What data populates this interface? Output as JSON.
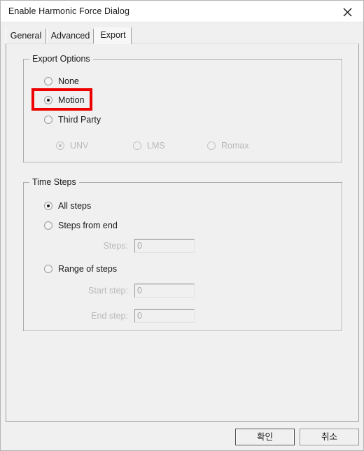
{
  "window": {
    "title": "Enable Harmonic Force Dialog",
    "close_icon": "close-icon"
  },
  "tabs": [
    {
      "id": "general",
      "label": "General",
      "selected": false
    },
    {
      "id": "advanced",
      "label": "Advanced",
      "selected": false
    },
    {
      "id": "export",
      "label": "Export",
      "selected": true
    }
  ],
  "export_options": {
    "group_title": "Export Options",
    "radios": [
      {
        "id": "none",
        "label": "None",
        "checked": false,
        "disabled": false
      },
      {
        "id": "motion",
        "label": "Motion",
        "checked": true,
        "disabled": false
      },
      {
        "id": "third_party",
        "label": "Third Party",
        "checked": false,
        "disabled": false
      }
    ],
    "formats": [
      {
        "id": "unv",
        "label": "UNV",
        "checked": true,
        "disabled": true
      },
      {
        "id": "lms",
        "label": "LMS",
        "checked": false,
        "disabled": true
      },
      {
        "id": "romax",
        "label": "Romax",
        "checked": false,
        "disabled": true
      }
    ]
  },
  "time_steps": {
    "group_title": "Time Steps",
    "radios": [
      {
        "id": "all_steps",
        "label": "All steps",
        "checked": true,
        "disabled": false
      },
      {
        "id": "steps_from_end",
        "label": "Steps from end",
        "checked": false,
        "disabled": false
      },
      {
        "id": "range_of_steps",
        "label": "Range of steps",
        "checked": false,
        "disabled": false
      }
    ],
    "fields": [
      {
        "id": "steps",
        "label": "Steps:",
        "value": "0",
        "disabled": true
      },
      {
        "id": "start_step",
        "label": "Start step:",
        "value": "0",
        "disabled": true
      },
      {
        "id": "end_step",
        "label": "End step:",
        "value": "0",
        "disabled": true
      }
    ]
  },
  "annotation": {
    "highlight_target": "motion",
    "color": "#ee0000"
  },
  "footer": {
    "ok_label": "확인",
    "cancel_label": "취소"
  }
}
